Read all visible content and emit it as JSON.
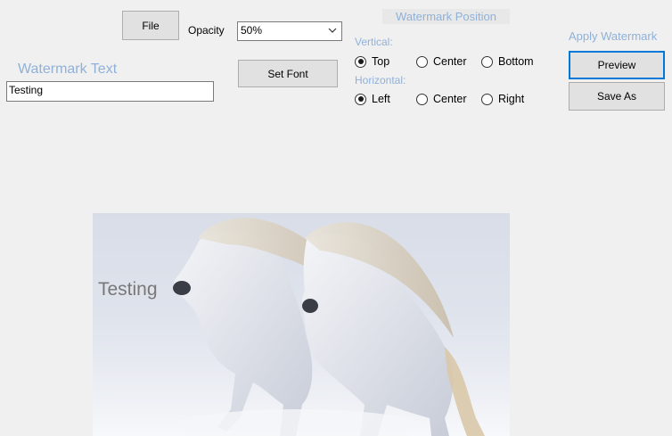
{
  "toolbar": {
    "file_label": "File",
    "opacity_label": "Opacity",
    "opacity_value": "50%",
    "set_font_label": "Set Font"
  },
  "watermark_text": {
    "label": "Watermark Text",
    "value": "Testing"
  },
  "position": {
    "title": "Watermark Position",
    "vertical_label": "Vertical:",
    "vertical_options": [
      "Top",
      "Center",
      "Bottom"
    ],
    "vertical_selected": "Top",
    "horizontal_label": "Horizontal:",
    "horizontal_options": [
      "Left",
      "Center",
      "Right"
    ],
    "horizontal_selected": "Left"
  },
  "apply": {
    "title": "Apply Watermark",
    "preview_label": "Preview",
    "save_as_label": "Save As"
  },
  "preview_image": {
    "subject": "two white horses galloping in snow",
    "watermark_overlay": "Testing"
  },
  "colors": {
    "group_title": "#8fb1d9",
    "focus_border": "#0078d7",
    "window_bg": "#f0f0f0"
  }
}
